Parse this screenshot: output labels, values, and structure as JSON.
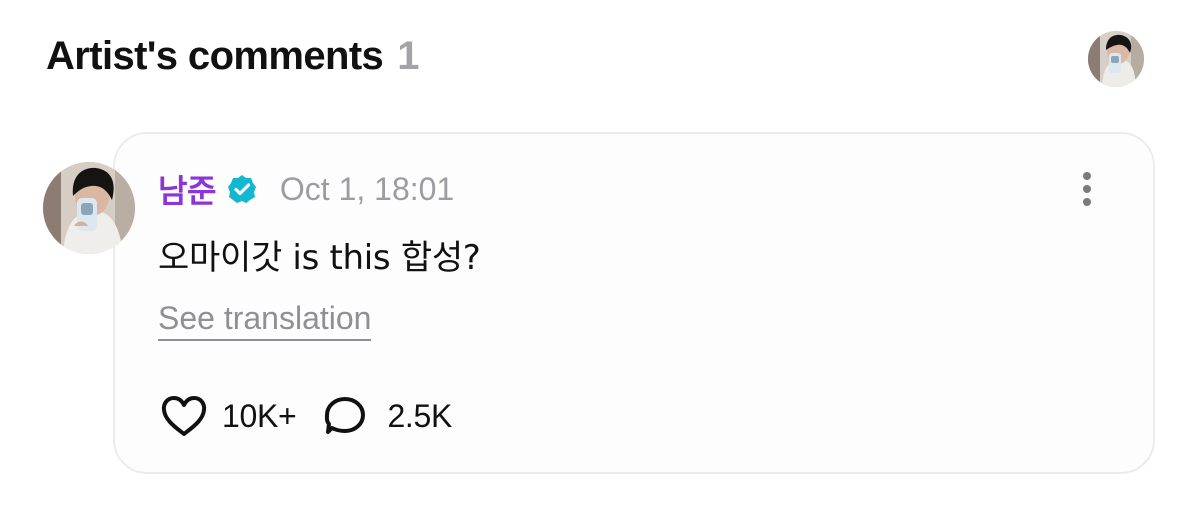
{
  "section": {
    "title": "Artist's comments",
    "count": "1"
  },
  "comment": {
    "author": "남준",
    "verified_icon": "verified-check-icon",
    "time": "Oct 1, 18:01",
    "text": "오마이갓 is this 합성?",
    "translate_label": "See translation",
    "like_icon": "heart-icon",
    "like_count": "10K+",
    "reply_icon": "speech-bubble-icon",
    "reply_count": "2.5K",
    "more_icon": "more-vertical-icon"
  },
  "colors": {
    "author_name": "#8b35d6",
    "verified_badge": "#12b8d2",
    "muted_text": "#9c9ca1",
    "card_border": "#ececee"
  }
}
